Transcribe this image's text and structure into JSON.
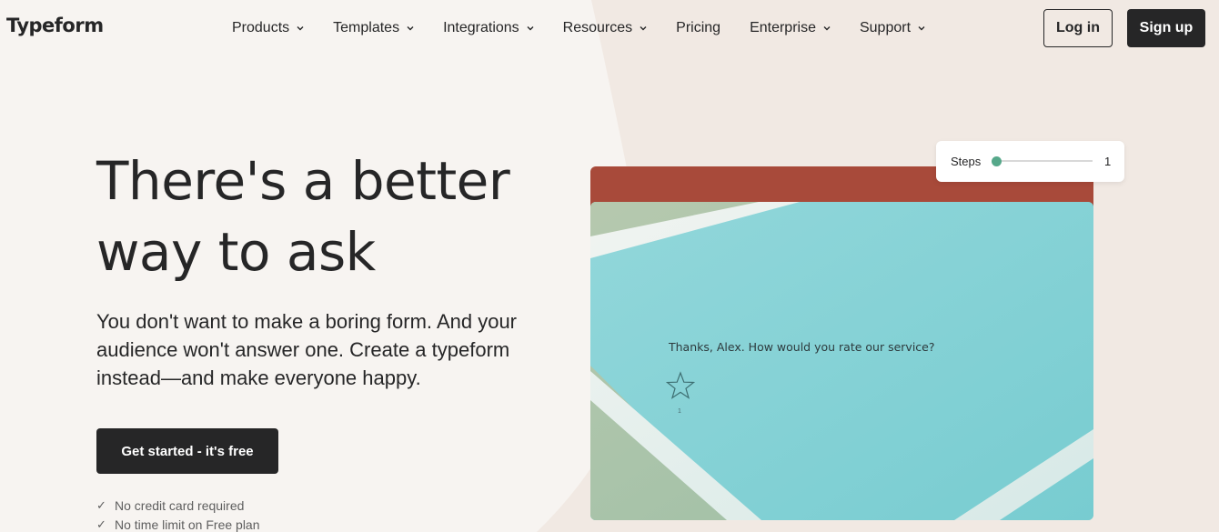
{
  "brand": {
    "logo_text": "Typeform"
  },
  "nav": {
    "items": [
      {
        "label": "Products",
        "has_dropdown": true
      },
      {
        "label": "Templates",
        "has_dropdown": true
      },
      {
        "label": "Integrations",
        "has_dropdown": true
      },
      {
        "label": "Resources",
        "has_dropdown": true
      },
      {
        "label": "Pricing",
        "has_dropdown": false
      },
      {
        "label": "Enterprise",
        "has_dropdown": true
      },
      {
        "label": "Support",
        "has_dropdown": true
      }
    ],
    "login_label": "Log in",
    "signup_label": "Sign up"
  },
  "hero": {
    "title_line1": "There's a better",
    "title_line2": "way to ask",
    "subtitle": "You don't want to make a boring form. And your audience won't answer one. Create a typeform instead—and make everyone happy.",
    "cta_label": "Get started - it's free",
    "perks": [
      "No credit card required",
      "No time limit on Free plan"
    ]
  },
  "preview": {
    "question": "Thanks, Alex. How would you rate our service?",
    "star_number": "1",
    "steps_label": "Steps",
    "steps_value": "1",
    "steps_level": 0
  },
  "colors": {
    "dark": "#262627",
    "card_header": "#a84a3a",
    "card_bg": "#7dced3",
    "accent_green": "#56a88a",
    "page_bg": "#f7f4f1"
  },
  "icons": {
    "nav_dropdown": "chevron-down-icon",
    "perk": "check-icon",
    "rating": "star-icon"
  }
}
